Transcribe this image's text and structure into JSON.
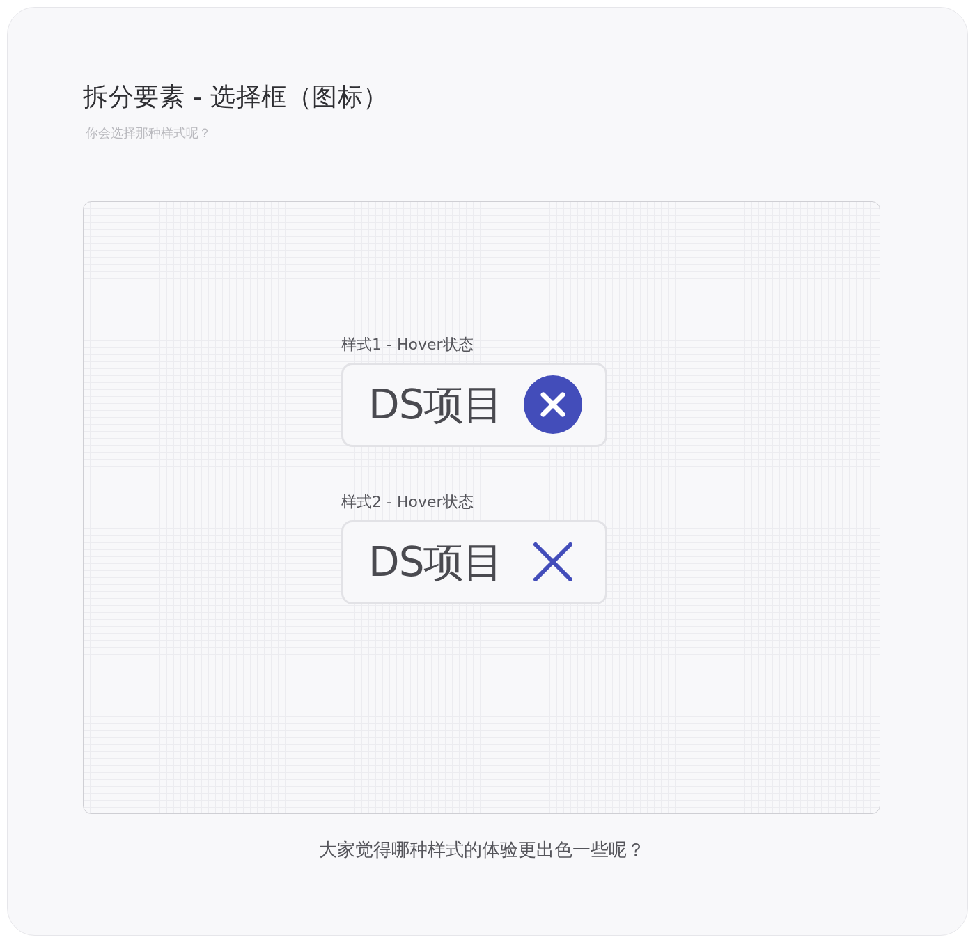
{
  "title": "拆分要素 - 选择框（图标）",
  "subtitle": "你会选择那种样式呢？",
  "samples": [
    {
      "label": "样式1 - Hover状态",
      "tag_text": "DS项目",
      "kind": "circle-cross"
    },
    {
      "label": "样式2 - Hover状态",
      "tag_text": "DS项目",
      "kind": "cross"
    }
  ],
  "footer": "大家觉得哪种样式的体验更出色一些呢？"
}
